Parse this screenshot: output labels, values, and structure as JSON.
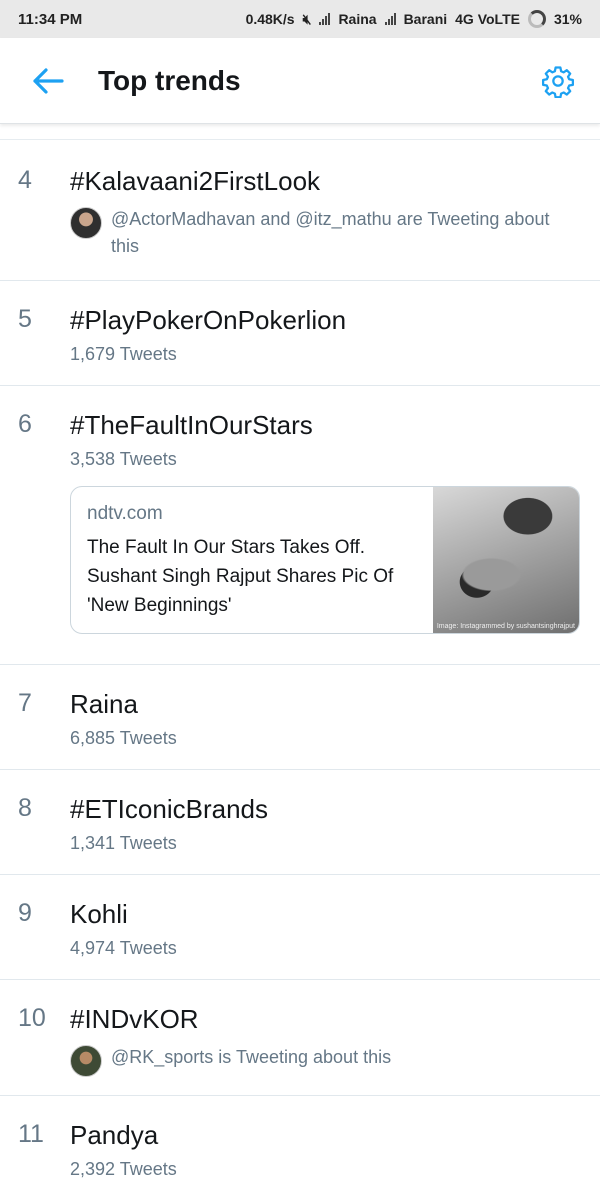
{
  "status": {
    "time": "11:34 PM",
    "speed": "0.48K/s",
    "carrier1": "Raina",
    "carrier2": "Barani",
    "network": "4G VoLTE",
    "battery": "31%"
  },
  "header": {
    "title": "Top trends"
  },
  "colors": {
    "accent": "#1da1f2",
    "muted": "#657786",
    "text": "#14171a",
    "divider": "#e1e8ed"
  },
  "trends": [
    {
      "rank": "4",
      "name": "#Kalavaani2FirstLook",
      "tweeting": "@ActorMadhavan and @itz_mathu are Tweeting about this"
    },
    {
      "rank": "5",
      "name": "#PlayPokerOnPokerlion",
      "count": "1,679 Tweets"
    },
    {
      "rank": "6",
      "name": "#TheFaultInOurStars",
      "count": "3,538 Tweets",
      "card": {
        "domain": "ndtv.com",
        "headline": "The Fault In Our Stars Takes Off. Sushant Singh Rajput Shares Pic Of 'New Beginnings'",
        "image_caption": "Image: Instagrammed by sushantsinghrajput"
      }
    },
    {
      "rank": "7",
      "name": "Raina",
      "count": "6,885 Tweets"
    },
    {
      "rank": "8",
      "name": "#ETIconicBrands",
      "count": "1,341 Tweets"
    },
    {
      "rank": "9",
      "name": "Kohli",
      "count": "4,974 Tweets"
    },
    {
      "rank": "10",
      "name": "#INDvKOR",
      "tweeting": "@RK_sports is Tweeting about this"
    },
    {
      "rank": "11",
      "name": "Pandya",
      "count": "2,392 Tweets"
    }
  ]
}
